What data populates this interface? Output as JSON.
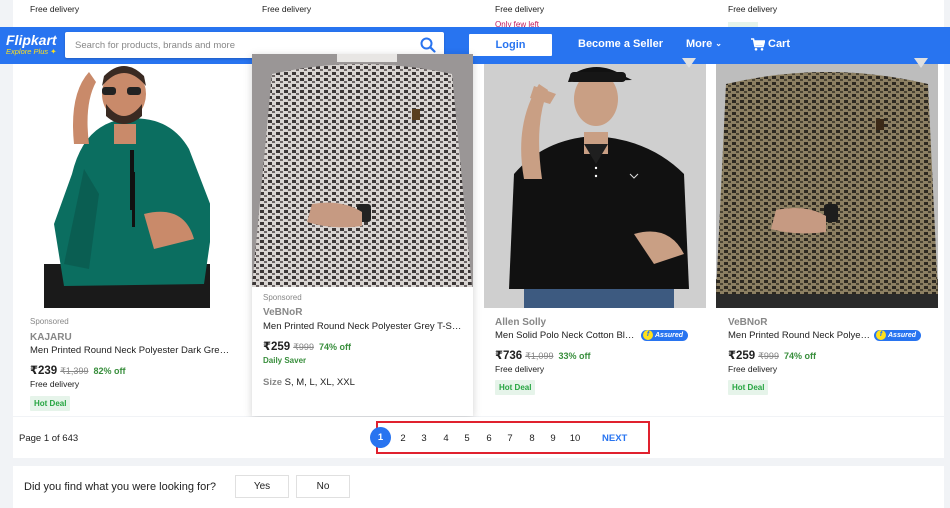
{
  "top_strip": {
    "cells": [
      "Free delivery",
      "Free delivery",
      "Free delivery",
      "Free delivery"
    ],
    "few_left": "Only few left"
  },
  "header": {
    "logo_brand": "Flipkart",
    "logo_tagline": "Explore",
    "logo_plus": "Plus",
    "search_placeholder": "Search for products, brands and more",
    "login_label": "Login",
    "seller_label": "Become a Seller",
    "more_label": "More",
    "cart_label": "Cart",
    "brand_color": "#2874f0"
  },
  "products": [
    {
      "sponsored": "Sponsored",
      "brand": "KAJARU",
      "title": "Men Printed Round Neck Polyester Dark Green T-Shirt",
      "price": "₹239",
      "mrp": "₹1,399",
      "off": "82% off",
      "delivery": "Free delivery",
      "badge": "Hot Deal"
    },
    {
      "sponsored": "Sponsored",
      "brand": "VeBNoR",
      "title": "Men Printed Round Neck Polyester Grey T-Shirt",
      "price": "₹259",
      "mrp": "₹999",
      "off": "74% off",
      "daily_saver": "Daily Saver",
      "sizes_label": "Size",
      "sizes": "S, M, L, XL, XXL"
    },
    {
      "brand": "Allen Solly",
      "title": "Men Solid Polo Neck Cotton Blend Black T-Shirt",
      "assured": "Assured",
      "price": "₹736",
      "mrp": "₹1,099",
      "off": "33% off",
      "delivery": "Free delivery",
      "badge": "Hot Deal"
    },
    {
      "brand": "VeBNoR",
      "title": "Men Printed Round Neck Polyester Brown T-Shirt",
      "assured": "Assured",
      "price": "₹259",
      "mrp": "₹999",
      "off": "74% off",
      "delivery": "Free delivery",
      "badge": "Hot Deal"
    }
  ],
  "pagination": {
    "info": "Page 1 of 643",
    "pages": [
      "1",
      "2",
      "3",
      "4",
      "5",
      "6",
      "7",
      "8",
      "9",
      "10"
    ],
    "current": "1",
    "next_label": "NEXT"
  },
  "feedback": {
    "question": "Did you find what you were looking for?",
    "yes_label": "Yes",
    "no_label": "No"
  }
}
